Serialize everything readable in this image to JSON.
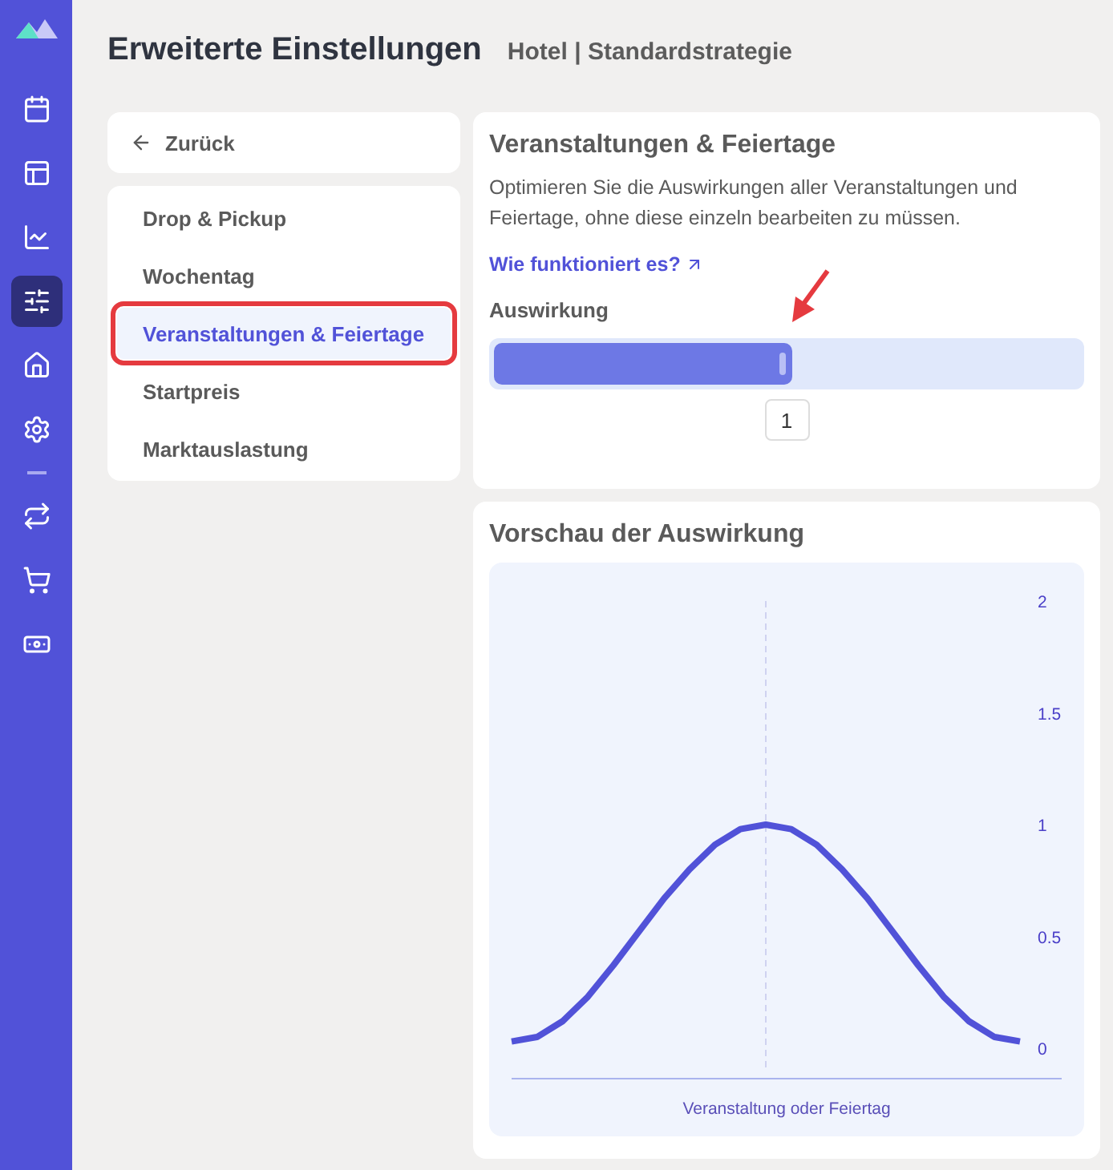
{
  "icon_rail": {
    "items": [
      {
        "kind": "calendar",
        "selected": false
      },
      {
        "kind": "layout",
        "selected": false
      },
      {
        "kind": "chart",
        "selected": false
      },
      {
        "kind": "sliders",
        "selected": true
      },
      {
        "kind": "building",
        "selected": false
      },
      {
        "kind": "settings",
        "selected": false
      },
      {
        "kind": "divider",
        "selected": false
      },
      {
        "kind": "repeat",
        "selected": false
      },
      {
        "kind": "cart",
        "selected": false
      },
      {
        "kind": "cash",
        "selected": false
      }
    ]
  },
  "header": {
    "title": "Erweiterte Einstellungen",
    "subtitle_left": "Hotel",
    "separator": "|",
    "subtitle_right": "Standardstrategie"
  },
  "back_link": {
    "label": "Zurück"
  },
  "settings_nav": [
    {
      "label": "Drop & Pickup",
      "selected": false,
      "highlighted": false
    },
    {
      "label": "Wochentag",
      "selected": false,
      "highlighted": false
    },
    {
      "label": "Veranstaltungen & Feiertage",
      "selected": true,
      "highlighted": true
    },
    {
      "label": "Startpreis",
      "selected": false,
      "highlighted": false
    },
    {
      "label": "Marktauslastung",
      "selected": false,
      "highlighted": false
    }
  ],
  "impact_card": {
    "title": "Veranstaltungen & Feiertage",
    "description": "Optimieren Sie die Auswirkungen aller Veranstaltungen und Feiertage, ohne diese einzeln bearbeiten zu müssen.",
    "help_link": "Wie funktioniert es?",
    "slider_label": "Auswirkung",
    "slider": {
      "level": 0.51,
      "reading": "1",
      "annotation_arrow": true
    }
  },
  "preview_card": {
    "title": "Vorschau der Auswirkung",
    "chart_data": {
      "type": "line",
      "xlabel": "Veranstaltung oder Feiertag",
      "categories": [
        null,
        null,
        null,
        null,
        null,
        null,
        null,
        null,
        null,
        null,
        null,
        null,
        null,
        null,
        null,
        null,
        null,
        null,
        null,
        null,
        null
      ],
      "ylim": [
        0,
        2
      ],
      "yticks": [
        0,
        0.5,
        1,
        1.5,
        2
      ],
      "series": [
        {
          "color": "#5152d8",
          "values": [
            0.03,
            0.05,
            0.12,
            0.23,
            0.37,
            0.52,
            0.67,
            0.8,
            0.91,
            0.98,
            1,
            0.98,
            0.91,
            0.8,
            0.67,
            0.52,
            0.37,
            0.23,
            0.12,
            0.05,
            0.03
          ]
        }
      ]
    }
  }
}
